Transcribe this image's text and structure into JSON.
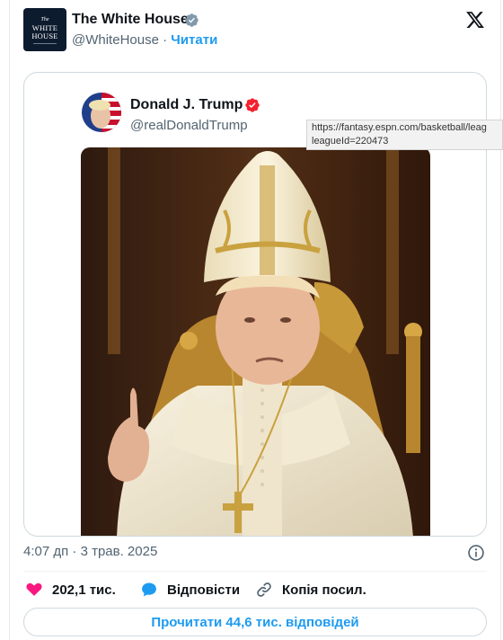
{
  "tweet": {
    "author": {
      "name": "The White House",
      "handle": "@WhiteHouse",
      "separator": "·",
      "follow_label": "Читати",
      "avatar_lines": [
        "The",
        "WHITE",
        "HOUSE"
      ]
    },
    "quoted": {
      "name": "Donald J. Trump",
      "handle": "@realDonaldTrump",
      "image_icon": "ai-generated-pope-portrait-image"
    },
    "timestamp": "4:07 дп · 3 трав. 2025",
    "actions": {
      "likes": "202,1 тис.",
      "reply_label": "Відповісти",
      "copy_label": "Копія посил."
    },
    "read_replies_label": "Прочитати 44,6 тис. відповідей"
  },
  "tooltip": {
    "line1": "https://fantasy.espn.com/basketball/leag",
    "line2": "leagueId=220473"
  },
  "colors": {
    "accent": "#1d9bf0",
    "verified_gold_gray": "#829aab",
    "verified_red": "#f4212e",
    "like_pink": "#f91880",
    "text_secondary": "#536471"
  }
}
